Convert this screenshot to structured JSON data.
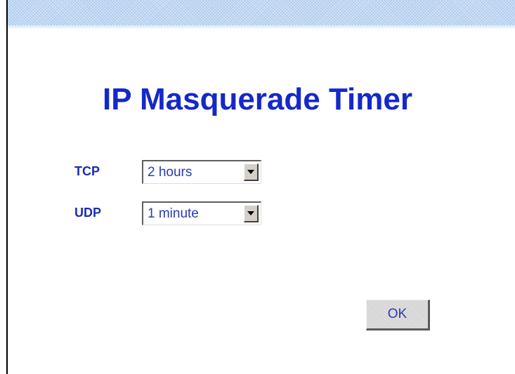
{
  "page": {
    "title": "IP Masquerade Timer"
  },
  "fields": {
    "tcp": {
      "label": "TCP",
      "selected": "2 hours"
    },
    "udp": {
      "label": "UDP",
      "selected": "1 minute"
    }
  },
  "buttons": {
    "ok_label": "OK"
  },
  "colors": {
    "title": "#1528c9",
    "label": "#1b2cb3",
    "value_text": "#2a3bb0",
    "band": "#d6e6f8",
    "button_face": "#d4d4d4"
  },
  "icons": {
    "dropdown": "chevron-down-icon"
  }
}
